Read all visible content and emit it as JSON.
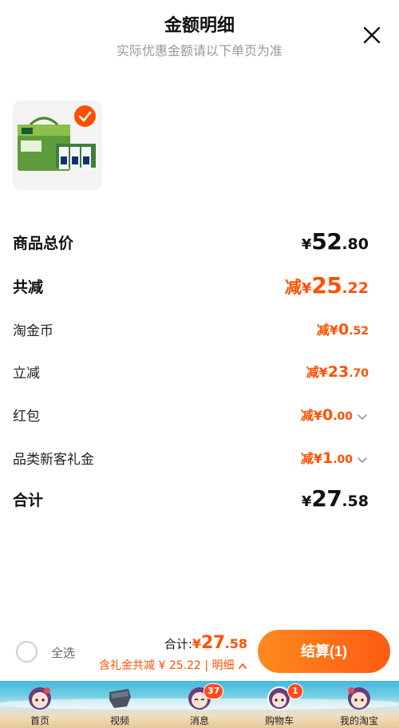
{
  "header": {
    "title": "金额明细",
    "subtitle": "实际优惠金额请以下单页为准"
  },
  "rows": [
    {
      "label": "商品总价",
      "prefix": "",
      "symbol": "¥",
      "integer": "52",
      "decimal": ".80"
    },
    {
      "label": "共减",
      "prefix": "减",
      "symbol": "¥",
      "integer": "25",
      "decimal": ".22"
    },
    {
      "label": "淘金币",
      "prefix": "减",
      "symbol": "¥",
      "integer": "0",
      "decimal": ".52"
    },
    {
      "label": "立减",
      "prefix": "减",
      "symbol": "¥",
      "integer": "23",
      "decimal": ".70"
    },
    {
      "label": "红包",
      "prefix": "减",
      "symbol": "¥",
      "integer": "0",
      "decimal": ".00"
    },
    {
      "label": "品类新客礼金",
      "prefix": "减",
      "symbol": "¥",
      "integer": "1",
      "decimal": ".00"
    },
    {
      "label": "合计",
      "prefix": "",
      "symbol": "¥",
      "integer": "27",
      "decimal": ".58"
    }
  ],
  "bottom": {
    "select_all": "全选",
    "total_label": "合计:",
    "total_symbol": "¥",
    "total_integer": "27",
    "total_decimal": ".58",
    "discount_text": "含礼金共减 ¥ 25.22 | 明细",
    "checkout_label": "结算(1)"
  },
  "tabbar": [
    {
      "label": "首页",
      "icon": "home-avatar-icon"
    },
    {
      "label": "视频",
      "icon": "video-icon"
    },
    {
      "label": "消息",
      "icon": "message-avatar-icon",
      "badge": "37"
    },
    {
      "label": "购物车",
      "icon": "cart-avatar-icon",
      "badge": "1"
    },
    {
      "label": "我的淘宝",
      "icon": "profile-avatar-icon"
    }
  ],
  "colors": {
    "accent": "#ff5000",
    "checkout_start": "#ff8a1e",
    "checkout_end": "#ff5a14"
  }
}
